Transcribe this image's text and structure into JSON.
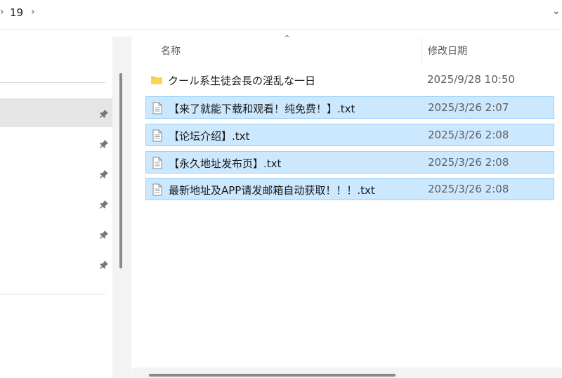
{
  "address_bar": {
    "separator_left": "›",
    "current_folder": "19",
    "separator_right": "›",
    "dropdown": "⌄"
  },
  "nav": {
    "pinned_count": 6
  },
  "file_list": {
    "sort_indicator": "^",
    "columns": {
      "name": "名称",
      "date_modified": "修改日期"
    },
    "rows": [
      {
        "type": "folder",
        "name": "クール系生徒会長の淫乱な一日",
        "date": "2025/9/28 10:50",
        "selected": false
      },
      {
        "type": "txt",
        "name": "【来了就能下载和观看！纯免费！】.txt",
        "date": "2025/3/26 2:07",
        "selected": true
      },
      {
        "type": "txt",
        "name": "【论坛介绍】.txt",
        "date": "2025/3/26 2:08",
        "selected": true
      },
      {
        "type": "txt",
        "name": "【永久地址发布页】.txt",
        "date": "2025/3/26 2:08",
        "selected": true
      },
      {
        "type": "txt",
        "name": "最新地址及APP请发邮箱自动获取！！！.txt",
        "date": "2025/3/26 2:08",
        "selected": true
      }
    ]
  },
  "colors": {
    "selection_fill": "#cce8ff",
    "selection_border": "#99d1ff",
    "folder_yellow": "#f8c33b",
    "nav_selected": "#e5e5e5"
  }
}
